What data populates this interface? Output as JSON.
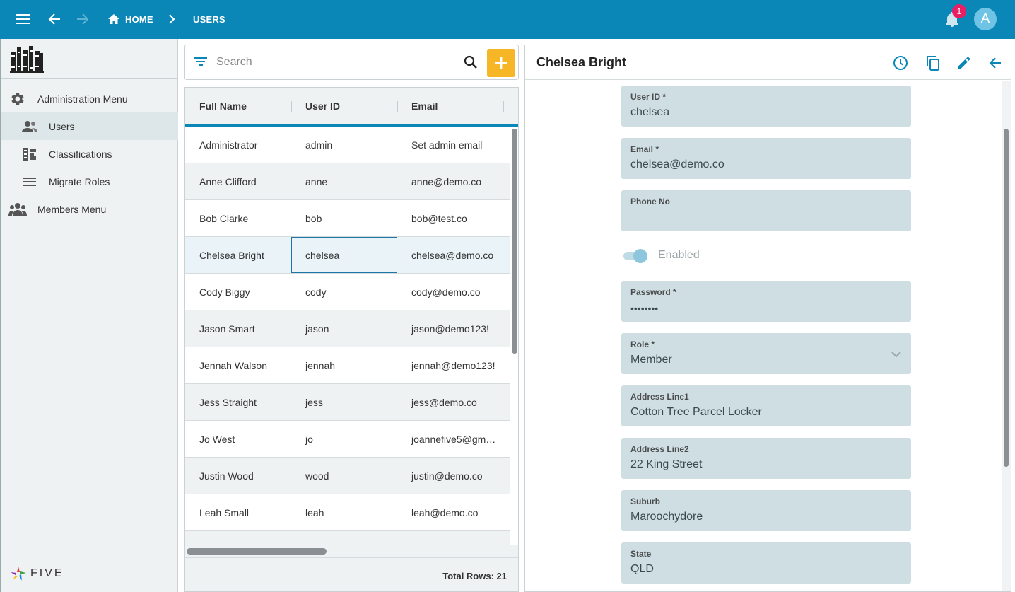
{
  "topbar": {
    "crumbs": [
      "HOME",
      "USERS"
    ],
    "notification_count": "1",
    "avatar_letter": "A"
  },
  "sidebar": {
    "items": [
      {
        "label": "Administration Menu",
        "icon": "gear-icon"
      },
      {
        "label": "Users",
        "icon": "users-icon",
        "active": true
      },
      {
        "label": "Classifications",
        "icon": "classifications-icon"
      },
      {
        "label": "Migrate Roles",
        "icon": "menu-lines-icon"
      },
      {
        "label": "Members Menu",
        "icon": "group-icon"
      }
    ],
    "footer_logo_text": "FIVE"
  },
  "list": {
    "search_placeholder": "Search",
    "columns": [
      "Full Name",
      "User ID",
      "Email"
    ],
    "rows": [
      [
        "Administrator",
        "admin",
        "Set admin email"
      ],
      [
        "Anne Clifford",
        "anne",
        "anne@demo.co"
      ],
      [
        "Bob Clarke",
        "bob",
        "bob@test.co"
      ],
      [
        "Chelsea Bright",
        "chelsea",
        "chelsea@demo.co"
      ],
      [
        "Cody Biggy",
        "cody",
        "cody@demo.co"
      ],
      [
        "Jason Smart",
        "jason",
        "jason@demo123!"
      ],
      [
        "Jennah Walson",
        "jennah",
        "jennah@demo123!"
      ],
      [
        "Jess Straight",
        "jess",
        "jess@demo.co"
      ],
      [
        "Jo West",
        "jo",
        "joannefive5@gm…"
      ],
      [
        "Justin Wood",
        "wood",
        "justin@demo.co"
      ],
      [
        "Leah Small",
        "leah",
        "leah@demo.co"
      ]
    ],
    "selected_row": 3,
    "total_rows": "Total Rows: 21"
  },
  "detail": {
    "title": "Chelsea Bright",
    "fields": [
      {
        "label": "User ID *",
        "value": "chelsea"
      },
      {
        "label": "Email *",
        "value": "chelsea@demo.co"
      },
      {
        "label": "Phone No",
        "value": ""
      },
      {
        "label": "Password *",
        "value": "••••••••"
      },
      {
        "label": "Role *",
        "value": "Member"
      },
      {
        "label": "Address Line1",
        "value": "Cotton Tree Parcel Locker"
      },
      {
        "label": "Address Line2",
        "value": "22 King Street"
      },
      {
        "label": "Suburb",
        "value": "Maroochydore"
      },
      {
        "label": "State",
        "value": "QLD"
      }
    ],
    "enabled_label": "Enabled",
    "enabled": true
  },
  "colors": {
    "topbar": "#0b87b7",
    "accent": "#f6b626",
    "badge": "#e91e63",
    "field_bg": "#cfdee3"
  }
}
